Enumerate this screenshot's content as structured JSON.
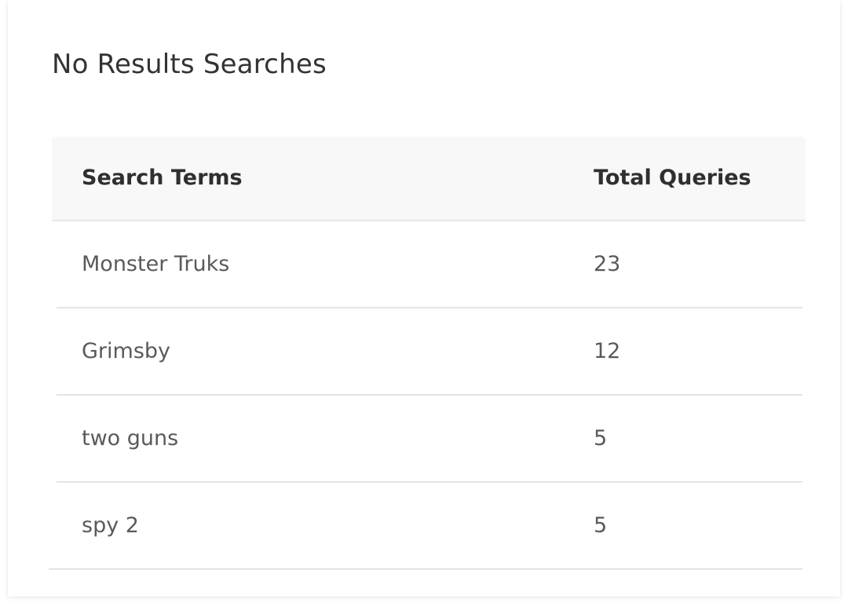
{
  "panel": {
    "title": "No Results Searches"
  },
  "table": {
    "headers": {
      "term": "Search Terms",
      "queries": "Total Queries"
    },
    "rows": [
      {
        "term": "Monster Truks",
        "queries": "23"
      },
      {
        "term": "Grimsby",
        "queries": "12"
      },
      {
        "term": "two guns",
        "queries": "5"
      },
      {
        "term": "spy 2",
        "queries": "5"
      }
    ]
  }
}
